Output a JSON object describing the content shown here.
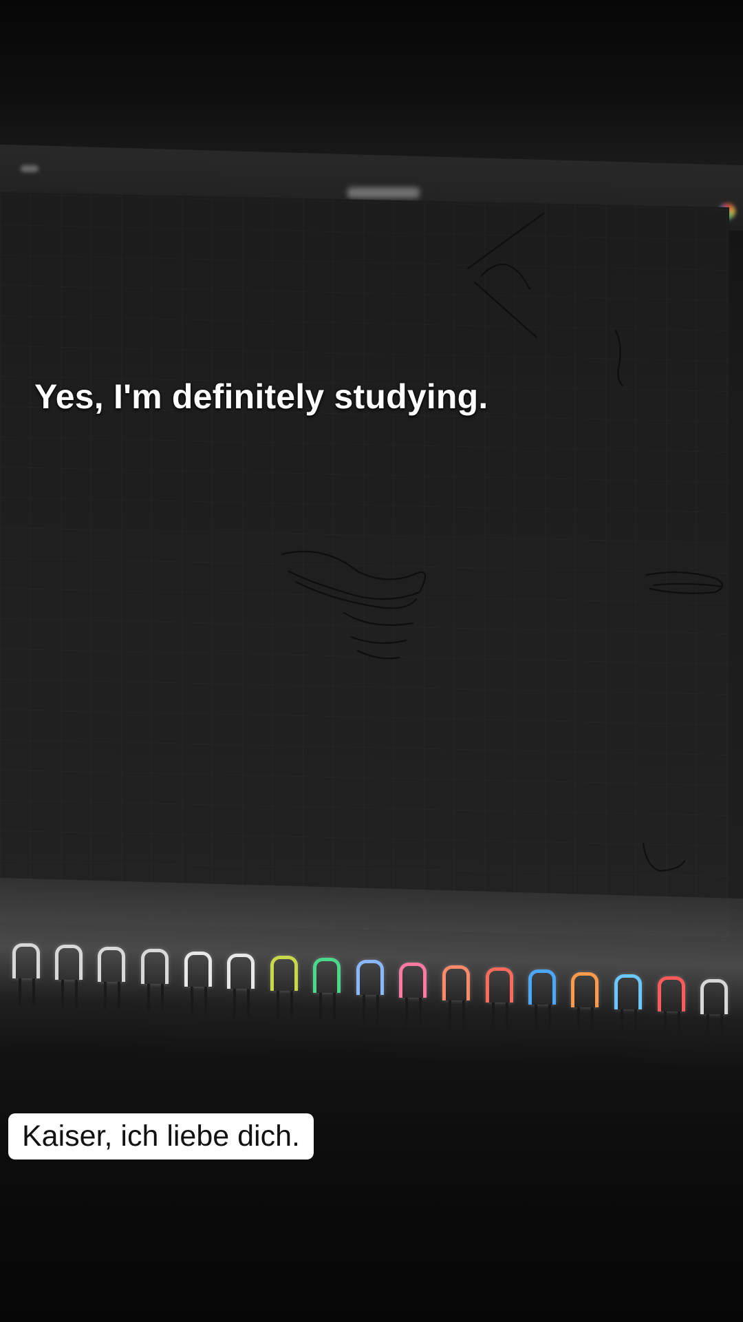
{
  "captions": {
    "top": "Yes, I'm definitely studying.",
    "bottom": "Kaiser, ich liebe dich."
  },
  "colors": {
    "background": "#0b0b0b",
    "caption_top_text": "#ffffff",
    "caption_bottom_bg": "#ffffff",
    "caption_bottom_text": "#111111",
    "ring_highlights": [
      "#d8d8d8",
      "#d8d8d8",
      "#d8d8d8",
      "#d8d8d8",
      "#d8d8d8",
      "#d8d8d8",
      "#c8d84a",
      "#4ad88a",
      "#8ab8ff",
      "#ff7aa0",
      "#ff8a6a",
      "#ff6a5a",
      "#4aa8ff",
      "#ff9a4a",
      "#6ac8ff",
      "#ff5a5a",
      "#d8d8d8"
    ]
  }
}
